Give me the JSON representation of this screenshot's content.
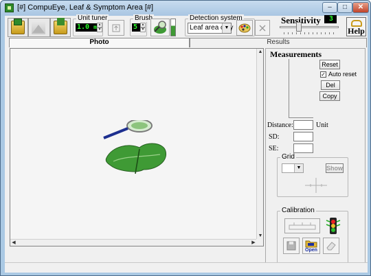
{
  "window": {
    "title": "[#] CompuEye, Leaf & Symptom Area [#]",
    "controls": {
      "minimize": "–",
      "maximize": "□",
      "close": "✕"
    }
  },
  "toolbar": {
    "unit_tuner": {
      "label": "Unit tuner",
      "value": "1.0",
      "unit": "mm"
    },
    "brush": {
      "label": "Brush",
      "value": "5"
    },
    "detection": {
      "label": "Detection system",
      "selected": "Leaf area only"
    },
    "sensitivity": {
      "label": "Sensitivity",
      "value": "3"
    },
    "help_label": "Help"
  },
  "tabs": [
    {
      "label": "Photo",
      "active": true
    },
    {
      "label": "Results",
      "active": false
    }
  ],
  "panel": {
    "title": "Measurements",
    "buttons": {
      "reset": "Reset",
      "del": "Del",
      "copy": "Copy"
    },
    "auto_reset": {
      "label": "Auto reset",
      "checked": true
    },
    "distance_label": "Distance:",
    "unit_label": "Unit",
    "sd_label": "SD:",
    "se_label": "SE:",
    "grid": {
      "label": "Grid",
      "show_label": "Show"
    },
    "calibration": {
      "label": "Calibration",
      "open_label": "Open"
    }
  },
  "icons": [
    "open-image-icon",
    "landscape-icon",
    "save-image-icon",
    "spin-up-icon",
    "magnifier-leaf-icon",
    "palette-icon",
    "close-x-icon",
    "key-icon",
    "traffic-light-icon",
    "floppy-icon",
    "open-folder-icon",
    "eraser-icon"
  ],
  "colors": {
    "lcd_green": "#2bff2b",
    "leaf_green": "#3f9a35",
    "titlebar": "#aac9e4"
  }
}
